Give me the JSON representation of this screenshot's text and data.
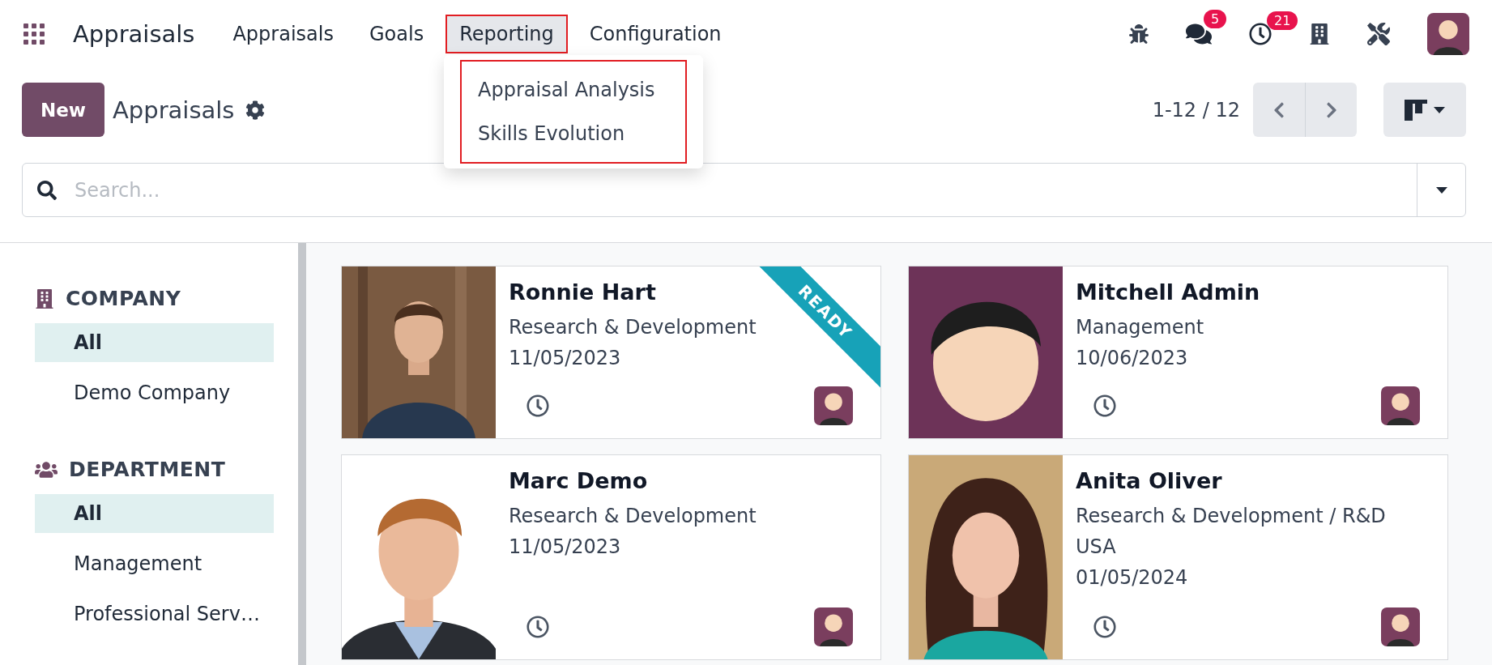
{
  "navbar": {
    "app_name": "Appraisals",
    "menu": [
      {
        "label": "Appraisals",
        "selected": false,
        "outlined": false
      },
      {
        "label": "Goals",
        "selected": false,
        "outlined": false
      },
      {
        "label": "Reporting",
        "selected": true,
        "outlined": true
      },
      {
        "label": "Configuration",
        "selected": false,
        "outlined": false
      }
    ],
    "messages_count": "5",
    "activities_count": "21"
  },
  "dropdown": {
    "outlined": true,
    "items": [
      "Appraisal Analysis",
      "Skills Evolution"
    ]
  },
  "control_panel": {
    "new_button": "New",
    "title": "Appraisals",
    "pager": "1-12 / 12"
  },
  "search": {
    "placeholder": "Search..."
  },
  "sidebar": {
    "sections": [
      {
        "kind": "company",
        "title": "COMPANY",
        "items": [
          {
            "label": "All",
            "selected": true
          },
          {
            "label": "Demo Company",
            "selected": false
          }
        ]
      },
      {
        "kind": "department",
        "title": "DEPARTMENT",
        "items": [
          {
            "label": "All",
            "selected": true
          },
          {
            "label": "Management",
            "selected": false
          },
          {
            "label": "Professional Serv…",
            "selected": false
          }
        ]
      }
    ]
  },
  "cards": [
    {
      "name": "Ronnie Hart",
      "lines": [
        "Research & Development",
        "11/05/2023"
      ],
      "ribbon": "READY",
      "photo": {
        "kind": "picture"
      }
    },
    {
      "name": "Mitchell Admin",
      "lines": [
        "Management",
        "10/06/2023"
      ],
      "photo": {
        "kind": "picture"
      }
    },
    {
      "name": "Marc Demo",
      "lines": [
        "Research & Development",
        "11/05/2023"
      ],
      "photo": {
        "kind": "picture"
      }
    },
    {
      "name": "Anita Oliver",
      "lines": [
        "Research & Development / R&D",
        "USA",
        "01/05/2024"
      ],
      "photo": {
        "kind": "picture"
      }
    }
  ]
}
